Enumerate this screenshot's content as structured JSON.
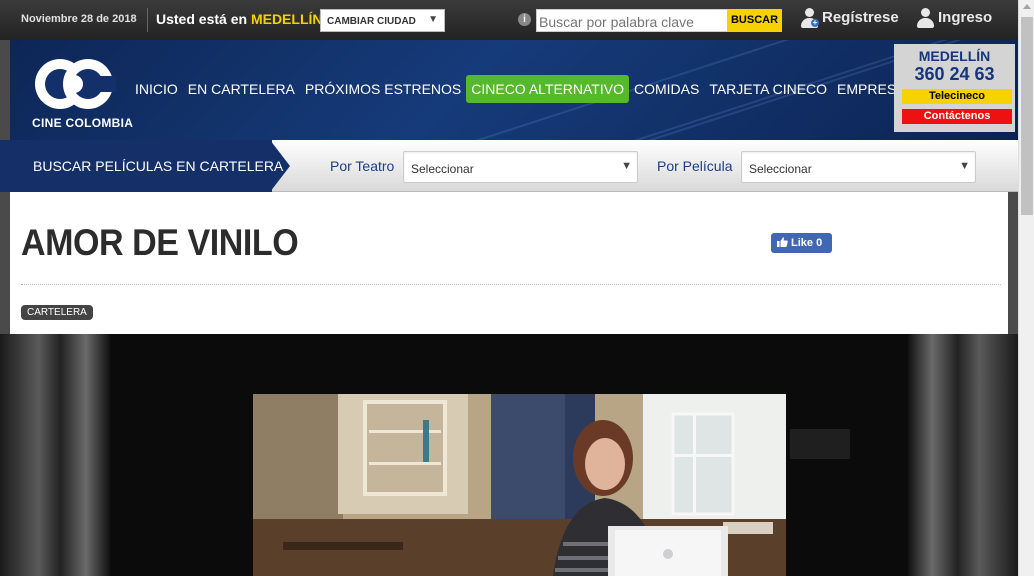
{
  "topbar": {
    "date": "Noviembre 28 de 2018",
    "location_prefix": "Usted está en",
    "city": "MEDELLÍN",
    "city_select": "CAMBIAR CIUDAD",
    "search_placeholder": "Buscar por palabra clave",
    "search_button": "BUSCAR",
    "register": "Regístrese",
    "login": "Ingreso"
  },
  "header": {
    "logo_text": "CINE COLOMBIA",
    "menu": [
      "INICIO",
      "EN CARTELERA",
      "PRÓXIMOS ESTRENOS",
      "CINECO ALTERNATIVO",
      "COMIDAS",
      "TARJETA CINECO",
      "EMPRESARIAL"
    ],
    "active_menu": "CINECO ALTERNATIVO",
    "contact": {
      "city": "MEDELLÍN",
      "phone": "360 24 63",
      "telecineco": "Telecineco",
      "contact_us": "Contáctenos"
    }
  },
  "filter": {
    "title": "BUSCAR PELÍCULAS EN CARTELERA",
    "theater_label": "Por Teatro",
    "theater_value": "Seleccionar",
    "movie_label": "Por Película",
    "movie_value": "Seleccionar"
  },
  "movie": {
    "title": "AMOR DE VINILO",
    "like_label": "Like 0",
    "tag": "CARTELERA"
  },
  "colors": {
    "accent_yellow": "#f6d300",
    "active_green": "#55b92c",
    "navy": "#153068",
    "red": "#ee1111"
  }
}
